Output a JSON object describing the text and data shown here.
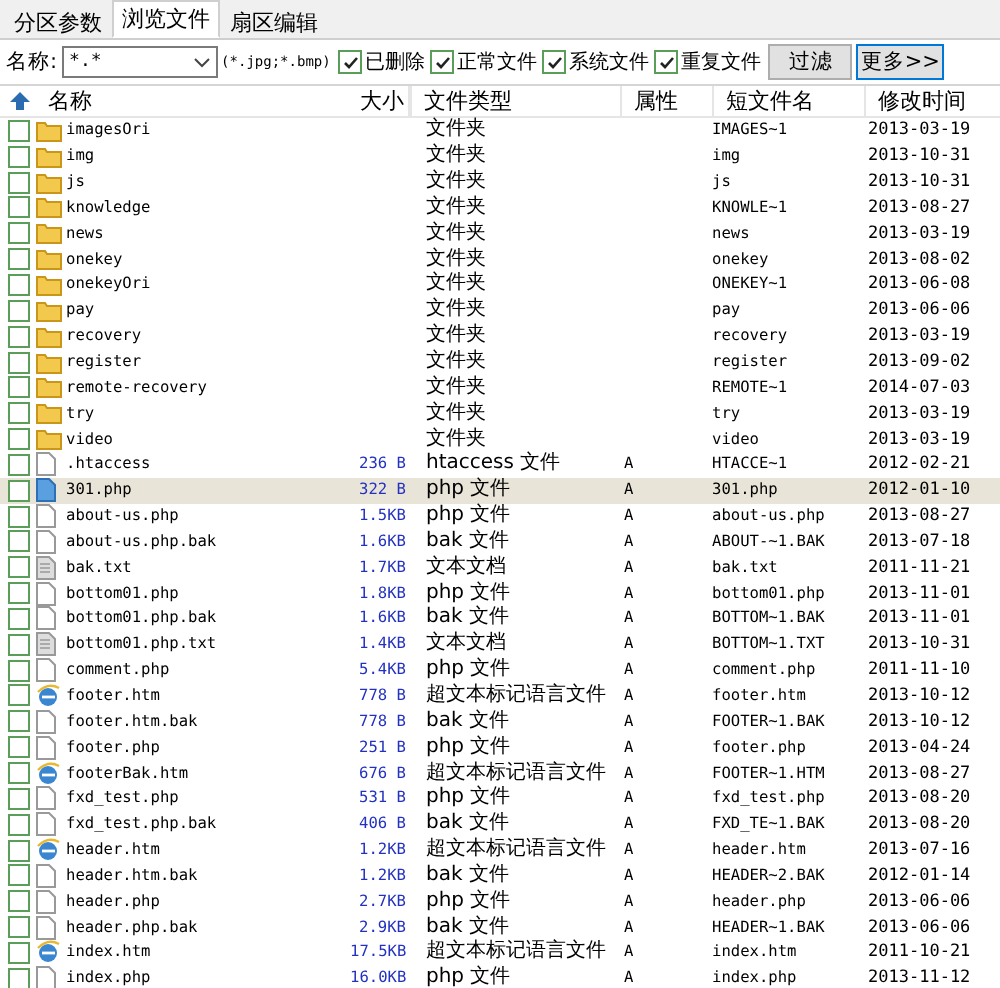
{
  "tabs": [
    {
      "label": "分区参数",
      "selected": false
    },
    {
      "label": "浏览文件",
      "selected": true
    },
    {
      "label": "扇区编辑",
      "selected": false
    }
  ],
  "filter": {
    "label": "名称:",
    "value": "*.*",
    "hint": "(*.jpg;*.bmp)",
    "options": [
      {
        "label": "已删除",
        "checked": true
      },
      {
        "label": "正常文件",
        "checked": true
      },
      {
        "label": "系统文件",
        "checked": true
      },
      {
        "label": "重复文件",
        "checked": true
      }
    ],
    "buttons": [
      "过滤",
      "更多>>"
    ]
  },
  "table": {
    "columns": [
      "名称",
      "大小",
      "文件类型",
      "属性",
      "短文件名",
      "修改时间"
    ],
    "rows": [
      {
        "kind": "folder",
        "checked": false,
        "selected": false,
        "name": "imagesOri",
        "size": "",
        "type": "文件夹",
        "attr": "",
        "short": "IMAGES~1",
        "modified": "2013-03-19"
      },
      {
        "kind": "folder",
        "checked": false,
        "selected": false,
        "name": "img",
        "size": "",
        "type": "文件夹",
        "attr": "",
        "short": "img",
        "modified": "2013-10-31"
      },
      {
        "kind": "folder",
        "checked": false,
        "selected": false,
        "name": "js",
        "size": "",
        "type": "文件夹",
        "attr": "",
        "short": "js",
        "modified": "2013-10-31"
      },
      {
        "kind": "folder",
        "checked": false,
        "selected": false,
        "name": "knowledge",
        "size": "",
        "type": "文件夹",
        "attr": "",
        "short": "KNOWLE~1",
        "modified": "2013-08-27"
      },
      {
        "kind": "folder",
        "checked": false,
        "selected": false,
        "name": "news",
        "size": "",
        "type": "文件夹",
        "attr": "",
        "short": "news",
        "modified": "2013-03-19"
      },
      {
        "kind": "folder",
        "checked": false,
        "selected": false,
        "name": "onekey",
        "size": "",
        "type": "文件夹",
        "attr": "",
        "short": "onekey",
        "modified": "2013-08-02"
      },
      {
        "kind": "folder",
        "checked": false,
        "selected": false,
        "name": "onekeyOri",
        "size": "",
        "type": "文件夹",
        "attr": "",
        "short": "ONEKEY~1",
        "modified": "2013-06-08"
      },
      {
        "kind": "folder",
        "checked": false,
        "selected": false,
        "name": "pay",
        "size": "",
        "type": "文件夹",
        "attr": "",
        "short": "pay",
        "modified": "2013-06-06"
      },
      {
        "kind": "folder",
        "checked": false,
        "selected": false,
        "name": "recovery",
        "size": "",
        "type": "文件夹",
        "attr": "",
        "short": "recovery",
        "modified": "2013-03-19"
      },
      {
        "kind": "folder",
        "checked": false,
        "selected": false,
        "name": "register",
        "size": "",
        "type": "文件夹",
        "attr": "",
        "short": "register",
        "modified": "2013-09-02"
      },
      {
        "kind": "folder",
        "checked": false,
        "selected": false,
        "name": "remote-recovery",
        "size": "",
        "type": "文件夹",
        "attr": "",
        "short": "REMOTE~1",
        "modified": "2014-07-03"
      },
      {
        "kind": "folder",
        "checked": false,
        "selected": false,
        "name": "try",
        "size": "",
        "type": "文件夹",
        "attr": "",
        "short": "try",
        "modified": "2013-03-19"
      },
      {
        "kind": "folder",
        "checked": false,
        "selected": false,
        "name": "video",
        "size": "",
        "type": "文件夹",
        "attr": "",
        "short": "video",
        "modified": "2013-03-19"
      },
      {
        "kind": "file",
        "checked": false,
        "selected": false,
        "name": ".htaccess",
        "size": "236 B",
        "type": "htaccess 文件",
        "attr": "A",
        "short": "HTACCE~1",
        "modified": "2012-02-21"
      },
      {
        "kind": "file",
        "checked": false,
        "selected": true,
        "name": "301.php",
        "size": "322 B",
        "type": "php 文件",
        "attr": "A",
        "short": "301.php",
        "modified": "2012-01-10"
      },
      {
        "kind": "file",
        "checked": false,
        "selected": false,
        "name": "about-us.php",
        "size": "1.5KB",
        "type": "php 文件",
        "attr": "A",
        "short": "about-us.php",
        "modified": "2013-08-27"
      },
      {
        "kind": "file",
        "checked": false,
        "selected": false,
        "name": "about-us.php.bak",
        "size": "1.6KB",
        "type": "bak 文件",
        "attr": "A",
        "short": "ABOUT-~1.BAK",
        "modified": "2013-07-18"
      },
      {
        "kind": "text",
        "checked": false,
        "selected": false,
        "name": "bak.txt",
        "size": "1.7KB",
        "type": "文本文档",
        "attr": "A",
        "short": "bak.txt",
        "modified": "2011-11-21"
      },
      {
        "kind": "file",
        "checked": false,
        "selected": false,
        "name": "bottom01.php",
        "size": "1.8KB",
        "type": "php 文件",
        "attr": "A",
        "short": "bottom01.php",
        "modified": "2013-11-01"
      },
      {
        "kind": "file",
        "checked": false,
        "selected": false,
        "name": "bottom01.php.bak",
        "size": "1.6KB",
        "type": "bak 文件",
        "attr": "A",
        "short": "BOTTOM~1.BAK",
        "modified": "2013-11-01"
      },
      {
        "kind": "text",
        "checked": false,
        "selected": false,
        "name": "bottom01.php.txt",
        "size": "1.4KB",
        "type": "文本文档",
        "attr": "A",
        "short": "BOTTOM~1.TXT",
        "modified": "2013-10-31"
      },
      {
        "kind": "file",
        "checked": false,
        "selected": false,
        "name": "comment.php",
        "size": "5.4KB",
        "type": "php 文件",
        "attr": "A",
        "short": "comment.php",
        "modified": "2011-11-10"
      },
      {
        "kind": "web",
        "checked": false,
        "selected": false,
        "name": "footer.htm",
        "size": "778 B",
        "type": "超文本标记语言文件",
        "attr": "A",
        "short": "footer.htm",
        "modified": "2013-10-12"
      },
      {
        "kind": "file",
        "checked": false,
        "selected": false,
        "name": "footer.htm.bak",
        "size": "778 B",
        "type": "bak 文件",
        "attr": "A",
        "short": "FOOTER~1.BAK",
        "modified": "2013-10-12"
      },
      {
        "kind": "file",
        "checked": false,
        "selected": false,
        "name": "footer.php",
        "size": "251 B",
        "type": "php 文件",
        "attr": "A",
        "short": "footer.php",
        "modified": "2013-04-24"
      },
      {
        "kind": "web",
        "checked": false,
        "selected": false,
        "name": "footerBak.htm",
        "size": "676 B",
        "type": "超文本标记语言文件",
        "attr": "A",
        "short": "FOOTER~1.HTM",
        "modified": "2013-08-27"
      },
      {
        "kind": "file",
        "checked": false,
        "selected": false,
        "name": "fxd_test.php",
        "size": "531 B",
        "type": "php 文件",
        "attr": "A",
        "short": "fxd_test.php",
        "modified": "2013-08-20"
      },
      {
        "kind": "file",
        "checked": false,
        "selected": false,
        "name": "fxd_test.php.bak",
        "size": "406 B",
        "type": "bak 文件",
        "attr": "A",
        "short": "FXD_TE~1.BAK",
        "modified": "2013-08-20"
      },
      {
        "kind": "web",
        "checked": false,
        "selected": false,
        "name": "header.htm",
        "size": "1.2KB",
        "type": "超文本标记语言文件",
        "attr": "A",
        "short": "header.htm",
        "modified": "2013-07-16"
      },
      {
        "kind": "file",
        "checked": false,
        "selected": false,
        "name": "header.htm.bak",
        "size": "1.2KB",
        "type": "bak 文件",
        "attr": "A",
        "short": "HEADER~2.BAK",
        "modified": "2012-01-14"
      },
      {
        "kind": "file",
        "checked": false,
        "selected": false,
        "name": "header.php",
        "size": "2.7KB",
        "type": "php 文件",
        "attr": "A",
        "short": "header.php",
        "modified": "2013-06-06"
      },
      {
        "kind": "file",
        "checked": false,
        "selected": false,
        "name": "header.php.bak",
        "size": "2.9KB",
        "type": "bak 文件",
        "attr": "A",
        "short": "HEADER~1.BAK",
        "modified": "2013-06-06"
      },
      {
        "kind": "web",
        "checked": false,
        "selected": false,
        "name": "index.htm",
        "size": "17.5KB",
        "type": "超文本标记语言文件",
        "attr": "A",
        "short": "index.htm",
        "modified": "2011-10-21"
      },
      {
        "kind": "file",
        "checked": false,
        "selected": false,
        "name": "index.php",
        "size": "16.0KB",
        "type": "php 文件",
        "attr": "A",
        "short": "index.php",
        "modified": "2013-11-12"
      }
    ]
  }
}
